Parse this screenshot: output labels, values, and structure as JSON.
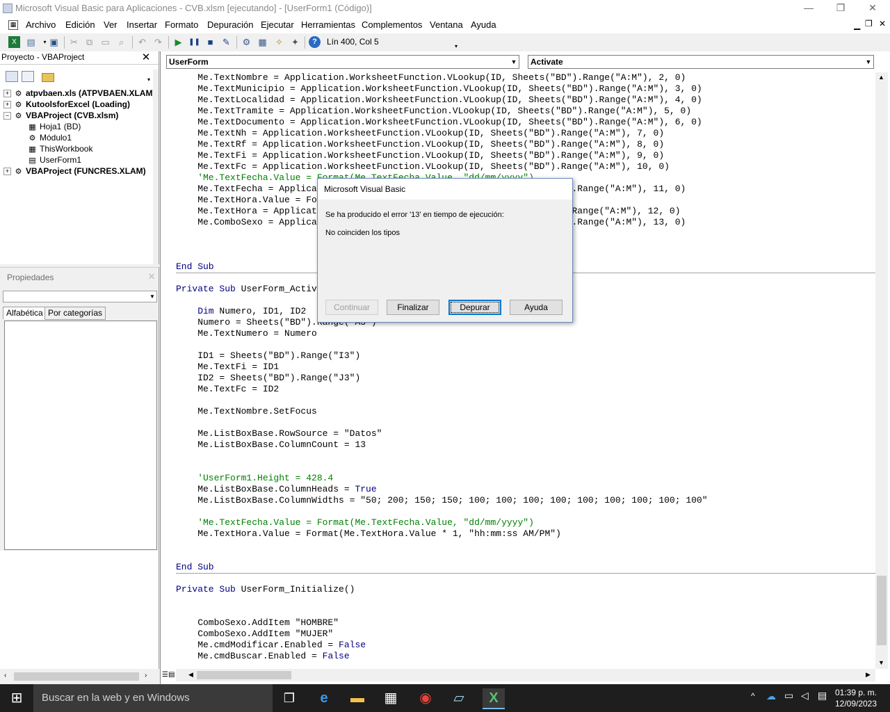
{
  "window": {
    "title": "Microsoft Visual Basic para Aplicaciones - CVB.xlsm [ejecutando] - [UserForm1 (Código)]",
    "minimize": "—",
    "restore": "❐",
    "close": "✕"
  },
  "menu": [
    "Archivo",
    "Edición",
    "Ver",
    "Insertar",
    "Formato",
    "Depuración",
    "Ejecutar",
    "Herramientas",
    "Complementos",
    "Ventana",
    "Ayuda"
  ],
  "toolbar": {
    "cursor_position": "Lín 400, Col 5"
  },
  "project": {
    "title": "Proyecto - VBAProject",
    "close": "✕",
    "tree": [
      {
        "label": "atpvbaen.xls (ATPVBAEN.XLAM)",
        "expander": "+"
      },
      {
        "label": "KutoolsforExcel (Loading)",
        "expander": "+"
      },
      {
        "label": "VBAProject (CVB.xlsm)",
        "expander": "−"
      },
      {
        "label": "Hoja1 (BD)"
      },
      {
        "label": "Módulo1"
      },
      {
        "label": "ThisWorkbook"
      },
      {
        "label": "UserForm1"
      },
      {
        "label": "VBAProject (FUNCRES.XLAM)",
        "expander": "+"
      }
    ]
  },
  "properties": {
    "title": "Propiedades",
    "close": "✕",
    "tabs": [
      "Alfabética",
      "Por categorías"
    ]
  },
  "code": {
    "object_combo": "UserForm",
    "procedure_combo": "Activate",
    "lines": [
      {
        "text": "    Me.TextNombre = Application.WorksheetFunction.VLookup(ID, Sheets(\"BD\").Range(\"A:M\"), 2, 0)"
      },
      {
        "text": "    Me.TextMunicipio = Application.WorksheetFunction.VLookup(ID, Sheets(\"BD\").Range(\"A:M\"), 3, 0)"
      },
      {
        "text": "    Me.TextLocalidad = Application.WorksheetFunction.VLookup(ID, Sheets(\"BD\").Range(\"A:M\"), 4, 0)"
      },
      {
        "text": "    Me.TextTramite = Application.WorksheetFunction.VLookup(ID, Sheets(\"BD\").Range(\"A:M\"), 5, 0)"
      },
      {
        "text": "    Me.TextDocumento = Application.WorksheetFunction.VLookup(ID, Sheets(\"BD\").Range(\"A:M\"), 6, 0)"
      },
      {
        "text": "    Me.TextNh = Application.WorksheetFunction.VLookup(ID, Sheets(\"BD\").Range(\"A:M\"), 7, 0)"
      },
      {
        "text": "    Me.TextRf = Application.WorksheetFunction.VLookup(ID, Sheets(\"BD\").Range(\"A:M\"), 8, 0)"
      },
      {
        "text": "    Me.TextFi = Application.WorksheetFunction.VLookup(ID, Sheets(\"BD\").Range(\"A:M\"), 9, 0)"
      },
      {
        "text": "    Me.TextFc = Application.WorksheetFunction.VLookup(ID, Sheets(\"BD\").Range(\"A:M\"), 10, 0)"
      },
      {
        "text": "    'Me.TextFecha.Value = Format(Me.TextFecha.Value, \"dd/mm/yyyy\")",
        "cls": "cm"
      },
      {
        "text": "    Me.TextFecha = Application.WorksheetFunction.VLookup(ID, Sheets(\"BD\").Range(\"A:M\"), 11, 0)"
      },
      {
        "text": "    Me.TextHora.Value = Format(Me.TextHora.Value * 1, \"hh:mm:ss AM/PM\")"
      },
      {
        "text": "    Me.TextHora = Application.WorksheetFunction.VLookup(ID, Sheets(\"BD\").Range(\"A:M\"), 12, 0)"
      },
      {
        "text": "    Me.ComboSexo = Application.WorksheetFunction.VLookup(ID, Sheets(\"BD\").Range(\"A:M\"), 13, 0)"
      },
      {
        "text": ""
      },
      {
        "text": ""
      },
      {
        "text": ""
      },
      {
        "text": "End Sub",
        "cls": "kw",
        "sep": true
      },
      {
        "text": ""
      },
      {
        "text": "Private Sub UserForm_Activate()",
        "kwprefix": "Private Sub "
      },
      {
        "text": ""
      },
      {
        "text": "    Dim Numero, ID1, ID2",
        "kwprefix": "    Dim "
      },
      {
        "text": "    Numero = Sheets(\"BD\").Range(\"A3\")"
      },
      {
        "text": "    Me.TextNumero = Numero"
      },
      {
        "text": ""
      },
      {
        "text": "    ID1 = Sheets(\"BD\").Range(\"I3\")"
      },
      {
        "text": "    Me.TextFi = ID1"
      },
      {
        "text": "    ID2 = Sheets(\"BD\").Range(\"J3\")"
      },
      {
        "text": "    Me.TextFc = ID2"
      },
      {
        "text": ""
      },
      {
        "text": "    Me.TextNombre.SetFocus"
      },
      {
        "text": ""
      },
      {
        "text": "    Me.ListBoxBase.RowSource = \"Datos\""
      },
      {
        "text": "    Me.ListBoxBase.ColumnCount = 13"
      },
      {
        "text": ""
      },
      {
        "text": ""
      },
      {
        "text": "    'UserForm1.Height = 428.4",
        "cls": "cm"
      },
      {
        "text": "    Me.ListBoxBase.ColumnHeads = True",
        "kwsuffix": "True"
      },
      {
        "text": "    Me.ListBoxBase.ColumnWidths = \"50; 200; 150; 150; 100; 100; 100; 100; 100; 100; 100; 100; 100\""
      },
      {
        "text": ""
      },
      {
        "text": "    'Me.TextFecha.Value = Format(Me.TextFecha.Value, \"dd/mm/yyyy\")",
        "cls": "cm"
      },
      {
        "text": "    Me.TextHora.Value = Format(Me.TextHora.Value * 1, \"hh:mm:ss AM/PM\")"
      },
      {
        "text": ""
      },
      {
        "text": ""
      },
      {
        "text": "End Sub",
        "cls": "kw",
        "sep": true
      },
      {
        "text": ""
      },
      {
        "text": "Private Sub UserForm_Initialize()",
        "kwprefix": "Private Sub "
      },
      {
        "text": ""
      },
      {
        "text": ""
      },
      {
        "text": "    ComboSexo.AddItem \"HOMBRE\""
      },
      {
        "text": "    ComboSexo.AddItem \"MUJER\""
      },
      {
        "text": "    Me.cmdModificar.Enabled = False",
        "kwsuffix": "False"
      },
      {
        "text": "    Me.cmdBuscar.Enabled = False",
        "kwsuffix": "False"
      }
    ]
  },
  "dialog": {
    "title": "Microsoft Visual Basic",
    "message": "Se ha producido el error '13' en tiempo de ejecución:",
    "detail": "No coinciden los tipos",
    "buttons": {
      "continue": "Continuar",
      "end": "Finalizar",
      "debug": "Depurar",
      "help": "Ayuda"
    }
  },
  "taskbar": {
    "search_placeholder": "Buscar en la web y en Windows",
    "time": "01:39 p. m.",
    "date": "12/09/2023"
  }
}
